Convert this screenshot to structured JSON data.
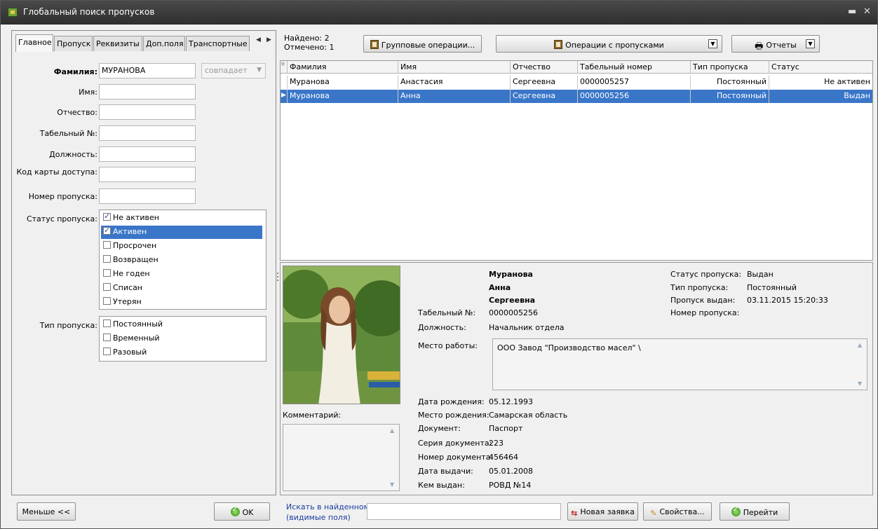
{
  "window": {
    "title": "Глобальный поиск пропусков",
    "minimize_label": "▬",
    "close_label": "✕"
  },
  "tabs": [
    "Главное",
    "Пропуск",
    "Реквизиты",
    "Доп.поля",
    "Транспортные"
  ],
  "form": {
    "last_name_label": "Фамилия:",
    "last_name_value": "МУРАНОВА",
    "match_mode": "совпадает",
    "first_name_label": "Имя:",
    "patronymic_label": "Отчество:",
    "tab_no_label": "Табельный №:",
    "position_label": "Должность:",
    "card_code_label": "Код карты доступа:",
    "pass_no_label": "Номер пропуска:",
    "pass_status_label": "Статус пропуска:",
    "pass_type_label": "Тип пропуска:",
    "status_options": [
      {
        "label": "Не активен",
        "checked": true,
        "selected": false
      },
      {
        "label": "Активен",
        "checked": true,
        "selected": true
      },
      {
        "label": "Просрочен",
        "checked": false,
        "selected": false
      },
      {
        "label": "Возвращен",
        "checked": false,
        "selected": false
      },
      {
        "label": "Не годен",
        "checked": false,
        "selected": false
      },
      {
        "label": "Списан",
        "checked": false,
        "selected": false
      },
      {
        "label": "Утерян",
        "checked": false,
        "selected": false
      }
    ],
    "type_options": [
      {
        "label": "Постоянный",
        "checked": false
      },
      {
        "label": "Временный",
        "checked": false
      },
      {
        "label": "Разовый",
        "checked": false
      }
    ]
  },
  "toolbar": {
    "found": "Найдено: 2",
    "marked": "Отмечено: 1",
    "group_ops": "Групповые операции...",
    "pass_ops": "Операции с пропусками",
    "reports": "Отчеты"
  },
  "grid": {
    "columns": [
      "Фамилия",
      "Имя",
      "Отчество",
      "Табельный номер",
      "Тип пропуска",
      "Статус"
    ],
    "rows": [
      {
        "cells": [
          "Муранова",
          "Анастасия",
          "Сергеевна",
          "0000005257",
          "Постоянный",
          "Не активен"
        ],
        "selected": false
      },
      {
        "cells": [
          "Муранова",
          "Анна",
          "Сергеевна",
          "0000005256",
          "Постоянный",
          "Выдан"
        ],
        "selected": true
      }
    ]
  },
  "detail": {
    "last_name": "Муранова",
    "first_name": "Анна",
    "patronymic": "Сергеевна",
    "tab_no_label": "Табельный №:",
    "tab_no": "0000005256",
    "position_label": "Должность:",
    "position": "Начальник отдела",
    "workplace_label": "Место работы:",
    "workplace": "ООО Завод \"Производство масел\" \\",
    "status_label": "Статус пропуска:",
    "status": "Выдан",
    "type_label": "Тип пропуска:",
    "type": "Постоянный",
    "issued_label": "Пропуск выдан:",
    "issued": "03.11.2015 15:20:33",
    "pass_no_label": "Номер пропуска:",
    "birth_date_label": "Дата рождения:",
    "birth_date": "05.12.1993",
    "birth_place_label": "Место рождения:",
    "birth_place": "Самарская область",
    "document_label": "Документ:",
    "document": "Паспорт",
    "doc_series_label": "Серия документа:",
    "doc_series": "223",
    "doc_number_label": "Номер документа:",
    "doc_number": "456464",
    "issue_date_label": "Дата выдачи:",
    "issue_date": "05.01.2008",
    "issued_by_label": "Кем выдан:",
    "issued_by": "РОВД №14",
    "comment_label": "Комментарий:"
  },
  "bottom": {
    "less": "Меньше <<",
    "ok": "OK",
    "search_label_1": "Искать в найденном",
    "search_label_2": "(видимые поля)",
    "new_request": "Новая заявка",
    "properties": "Свойства...",
    "go": "Перейти"
  }
}
